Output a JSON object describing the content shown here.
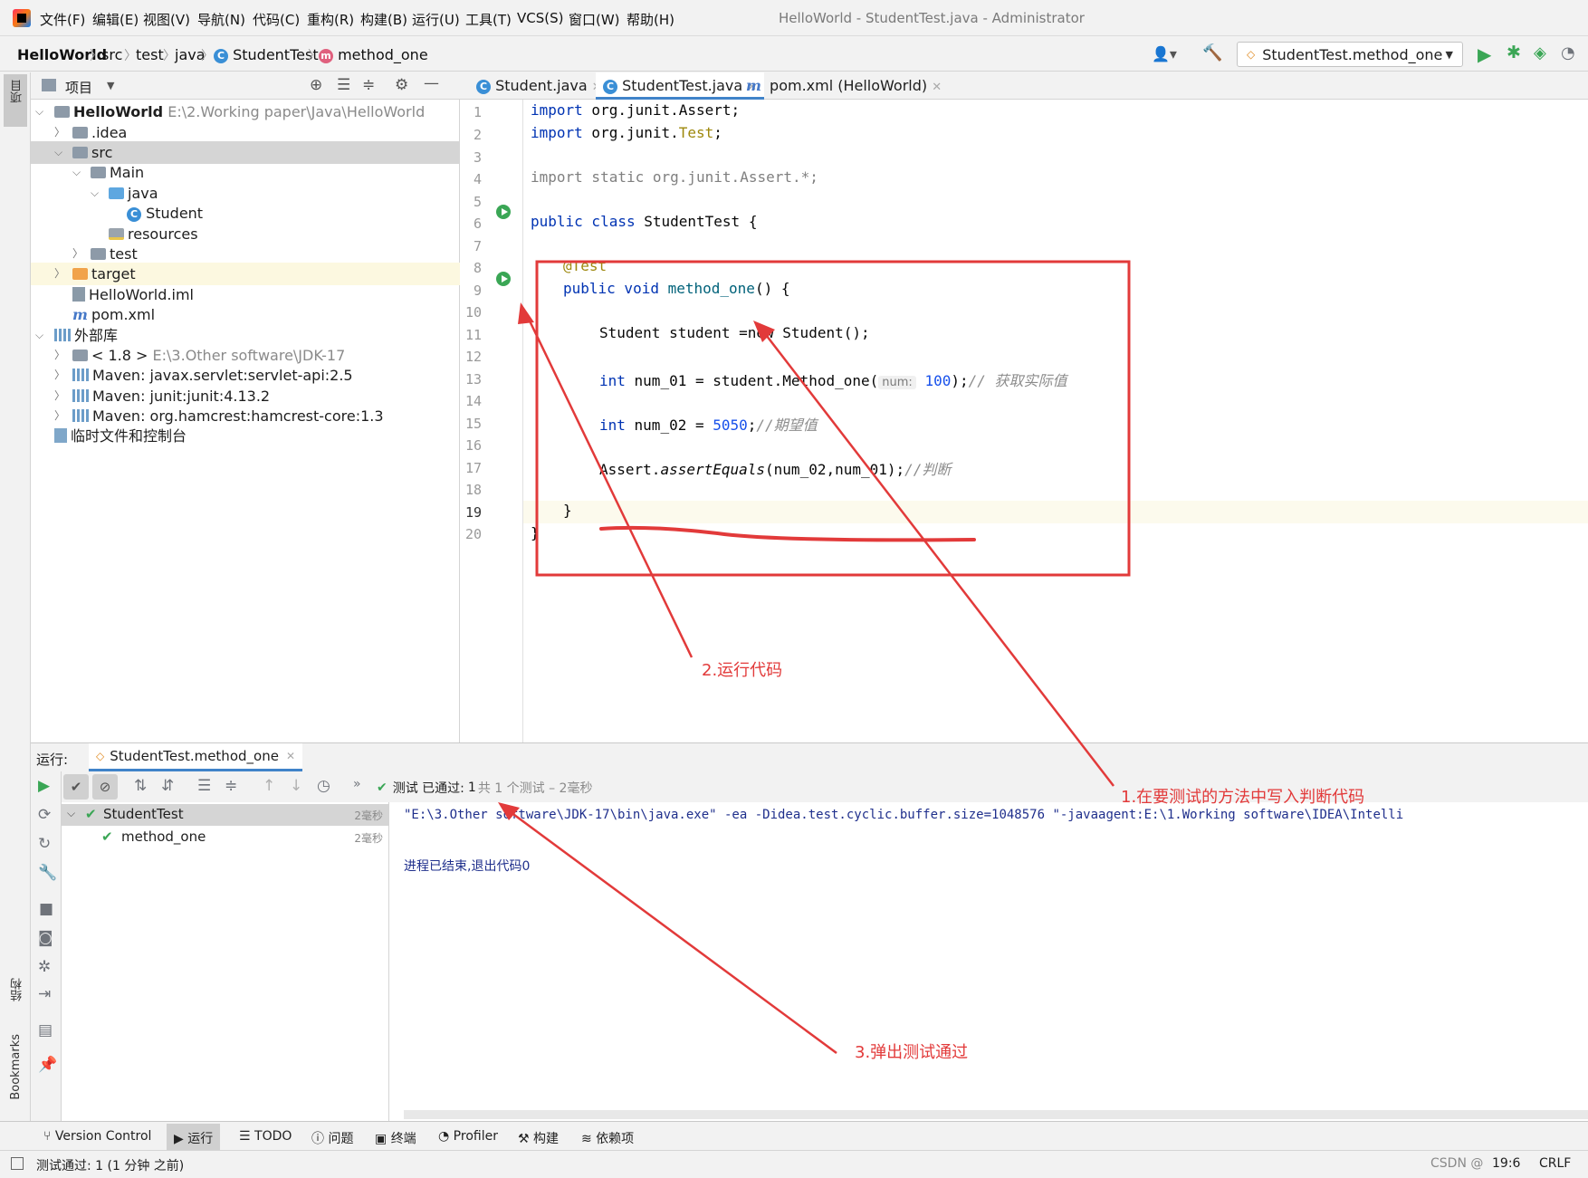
{
  "menu": {
    "items": [
      "文件(F)",
      "编辑(E)",
      "视图(V)",
      "导航(N)",
      "代码(C)",
      "重构(R)",
      "构建(B)",
      "运行(U)",
      "工具(T)",
      "VCS(S)",
      "窗口(W)",
      "帮助(H)"
    ],
    "window_title": "HelloWorld - StudentTest.java - Administrator"
  },
  "breadcrumb": [
    "HelloWorld",
    "src",
    "test",
    "java",
    "StudentTest",
    "method_one"
  ],
  "run_config": "StudentTest.method_one",
  "left_strip": {
    "project": "项目",
    "structure": "结构",
    "bookmarks": "Bookmarks"
  },
  "project": {
    "header": "项目",
    "tree": [
      {
        "label": "HelloWorld",
        "path": "E:\\2.Working paper\\Java\\HelloWorld"
      },
      {
        "label": ".idea"
      },
      {
        "label": "src"
      },
      {
        "label": "Main"
      },
      {
        "label": "java"
      },
      {
        "label": "Student"
      },
      {
        "label": "resources"
      },
      {
        "label": "test"
      },
      {
        "label": "target"
      },
      {
        "label": "HelloWorld.iml"
      },
      {
        "label": "pom.xml"
      },
      {
        "label": "外部库"
      },
      {
        "label": "< 1.8 >",
        "path": "E:\\3.Other software\\JDK-17"
      },
      {
        "label": "Maven: javax.servlet:servlet-api:2.5"
      },
      {
        "label": "Maven: junit:junit:4.13.2"
      },
      {
        "label": "Maven: org.hamcrest:hamcrest-core:1.3"
      },
      {
        "label": "临时文件和控制台"
      }
    ]
  },
  "editor": {
    "tabs": [
      "Student.java",
      "StudentTest.java",
      "pom.xml (HelloWorld)"
    ],
    "line_numbers": [
      "1",
      "2",
      "3",
      "4",
      "5",
      "6",
      "7",
      "8",
      "9",
      "10",
      "11",
      "12",
      "13",
      "14",
      "15",
      "16",
      "17",
      "18",
      "19",
      "20"
    ],
    "code": {
      "l1_kw": "import",
      "l1_rest": " org.junit.Assert;",
      "l2_kw": "import",
      "l2_pkg": " org.junit.",
      "l2_test": "Test",
      "l2_end": ";",
      "l4": "import static org.junit.Assert.*;",
      "l6_kw": "public class",
      "l6_rest": " StudentTest {",
      "l8": "@Test",
      "l9_kw": "public void",
      "l9_fn": " method_one",
      "l9_rest": "() {",
      "l11": "Student student =new Student();",
      "l13_kw": "int",
      "l13_rest": " num_01 = student.Method_one(",
      "l13_hint": "num:",
      "l13_num": "100",
      "l13_end": ");",
      "l13_cmt": "// 获取实际值",
      "l15_kw": "int",
      "l15_rest": " num_02 = ",
      "l15_num": "5050",
      "l15_end": ";",
      "l15_cmt": "//期望值",
      "l17_a": "Assert.",
      "l17_fn": "assertEquals",
      "l17_rest": "(num_02,num_01);",
      "l17_cmt": "//判断",
      "l19": "}",
      "l20": "}"
    }
  },
  "annotations": {
    "note1": "1.在要测试的方法中写入判断代码",
    "note2": "2.运行代码",
    "note3": "3.弹出测试通过"
  },
  "run_panel": {
    "label": "运行:",
    "tab": "StudentTest.method_one",
    "status_prefix": "测试 已通过:",
    "status_count": "1",
    "status_detail": "共 1 个测试 – 2毫秒",
    "tests": [
      {
        "name": "StudentTest",
        "time": "2毫秒"
      },
      {
        "name": "method_one",
        "time": "2毫秒"
      }
    ],
    "console_cmd": "\"E:\\3.Other software\\JDK-17\\bin\\java.exe\" -ea -Didea.test.cyclic.buffer.size=1048576 \"-javaagent:E:\\1.Working software\\IDEA\\Intelli",
    "console_exit": "进程已结束,退出代码0"
  },
  "tool_windows": [
    "Version Control",
    "运行",
    "TODO",
    "问题",
    "终端",
    "Profiler",
    "构建",
    "依赖项"
  ],
  "status": {
    "message": "测试通过: 1 (1 分钟 之前)",
    "position": "19:6",
    "line_ending": "CRLF",
    "watermark": "CSDN @"
  },
  "colors": {
    "accent": "#4083c9",
    "pass_green": "#3aa655",
    "annotation_red": "#e23a3a"
  }
}
